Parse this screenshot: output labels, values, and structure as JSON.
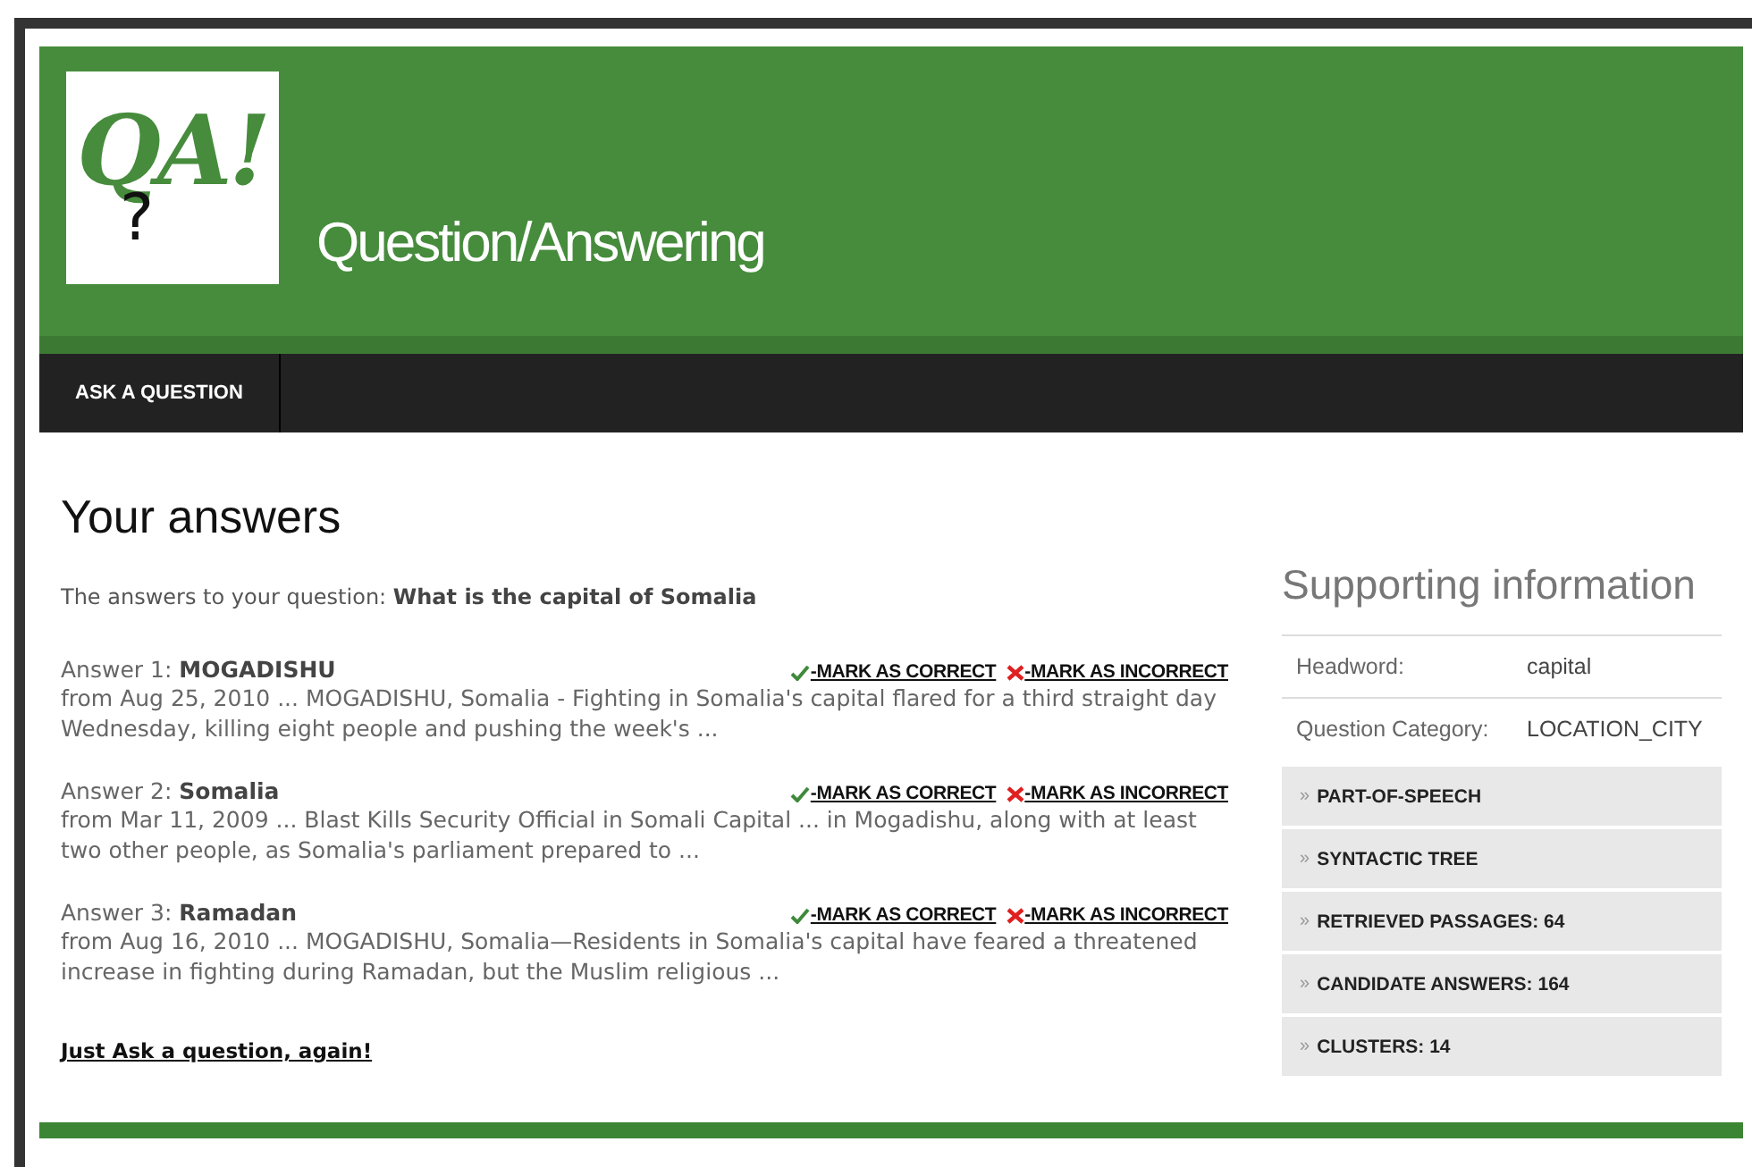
{
  "header": {
    "logo_text": "QA!",
    "logo_mark": "?",
    "title": "Question/Answering"
  },
  "nav": [
    {
      "label": "ASK A QUESTION",
      "selected": false
    }
  ],
  "main": {
    "heading": "Your answers",
    "intro": "The answers to your question: **What is the capital of Somalia**",
    "answers": [
      {
        "label": "Answer 1:",
        "answer": "MOGADISHU",
        "correct": "-MARK AS CORRECT",
        "incorrect": "-MARK AS INCORRECT",
        "snippet": "from Aug 25, 2010 ... MOGADISHU, Somalia - Fighting in Somalia's capital flared for a third straight day Wednesday, killing eight people and pushing the week's ..."
      },
      {
        "label": "Answer 2:",
        "answer": "Somalia",
        "correct": "-MARK AS CORRECT",
        "incorrect": "-MARK AS INCORRECT",
        "snippet": "from Mar 11, 2009 ... Blast Kills Security Official in Somali Capital ... in Mogadishu, along with at least two other people, as Somalia's parliament prepared to ..."
      },
      {
        "label": "Answer 3:",
        "answer": "Ramadan",
        "correct": "-MARK AS CORRECT",
        "incorrect": "-MARK AS INCORRECT",
        "snippet": "from Aug 16, 2010 ... MOGADISHU, Somalia—Residents in Somalia's capital have feared a threatened increase in fighting during Ramadan, but the Muslim religious ..."
      }
    ],
    "again_link": "Just Ask a question, again!"
  },
  "sidebar": {
    "title": "Supporting information",
    "facts": [
      {
        "label": "Headword:",
        "value": "capital"
      },
      {
        "label": "Question Category:",
        "value": "LOCATION_CITY"
      }
    ],
    "sections": [
      {
        "marker": "»",
        "label": "PART-OF-SPEECH"
      },
      {
        "marker": "»",
        "label": "SYNTACTIC TREE"
      },
      {
        "marker": "»",
        "label": "RETRIEVED PASSAGES: 64"
      },
      {
        "marker": "»",
        "label": "CANDIDATE ANSWERS: 164"
      },
      {
        "marker": "»",
        "label": "CLUSTERS: 14"
      }
    ]
  }
}
